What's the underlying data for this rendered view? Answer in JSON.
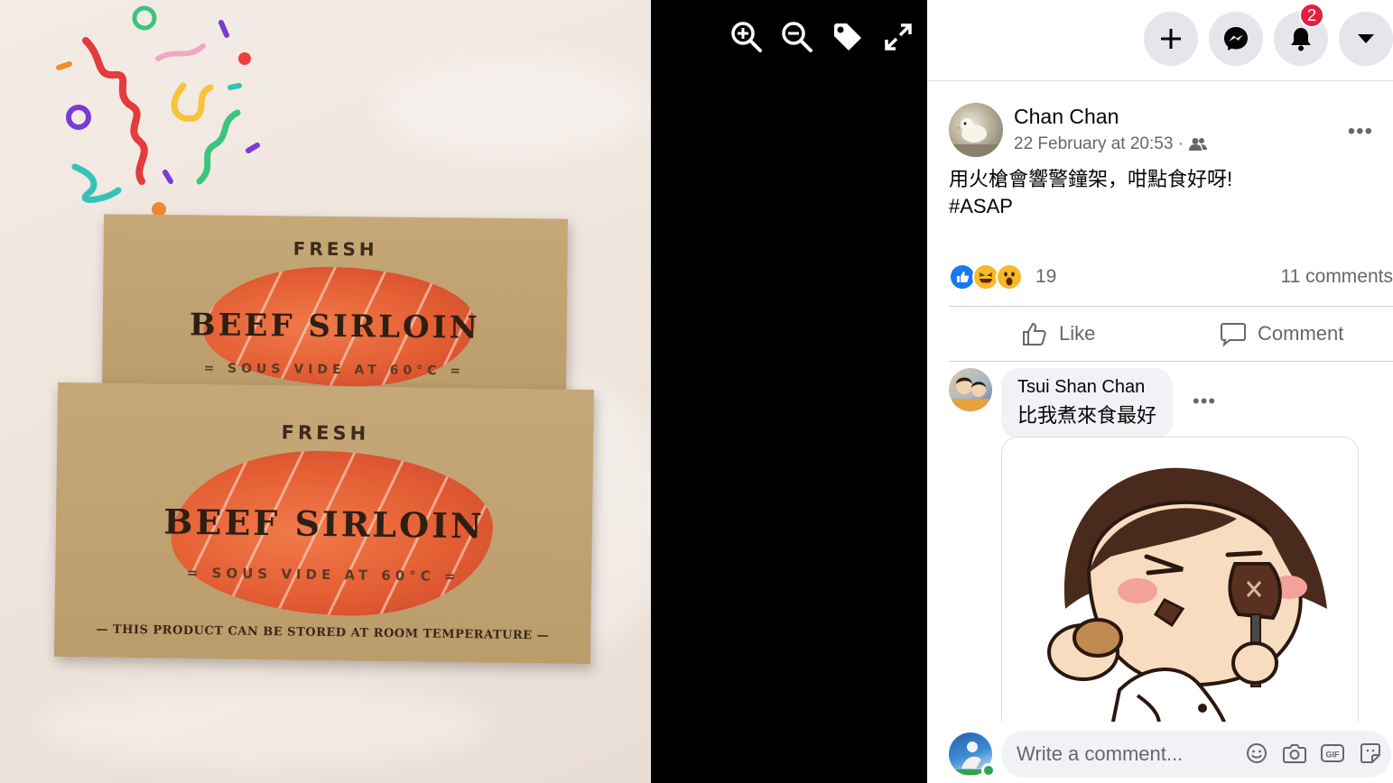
{
  "viewer": {
    "photo": {
      "box_top": {
        "fresh": "FRESH",
        "title": "BEEF SIRLOIN",
        "sub": "= SOUS VIDE AT 60°C ="
      },
      "box_bottom": {
        "fresh": "FRESH",
        "title": "BEEF SIRLOIN",
        "sub": "= SOUS VIDE AT 60°C =",
        "footer": "— THIS PRODUCT CAN BE STORED AT ROOM TEMPERATURE —"
      }
    },
    "tools": [
      "zoom-in-icon",
      "zoom-out-icon",
      "tag-icon",
      "fullscreen-icon"
    ]
  },
  "topbar": {
    "icons": [
      "plus-icon",
      "messenger-icon",
      "bell-icon",
      "caret-down-icon"
    ],
    "notification_count": "2"
  },
  "post": {
    "author": "Chan Chan",
    "timestamp": "22 February at 20:53 ·",
    "audience_icon": "friends-icon",
    "text_line1": "用火槍會響警鐘架，咁點食好呀!",
    "text_line2": "#ASAP",
    "reactions": {
      "icons": [
        "like",
        "haha",
        "wow"
      ],
      "count": "19",
      "comments": "11 comments"
    },
    "actions": {
      "like": "Like",
      "comment": "Comment"
    }
  },
  "comment": {
    "name": "Tsui Shan Chan",
    "text": "比我煮來食最好"
  },
  "composer": {
    "placeholder": "Write a comment...",
    "icons": [
      "emoji-icon",
      "camera-icon",
      "gif-icon",
      "sticker-icon"
    ]
  },
  "colors": {
    "fb_blue": "#1877f2",
    "badge_red": "#e41e3f",
    "secondary_text": "#65676b"
  }
}
